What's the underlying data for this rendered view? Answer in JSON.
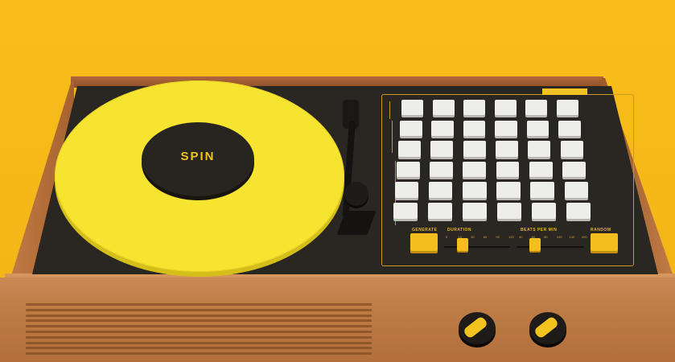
{
  "record_label": "SPIN",
  "panel": {
    "controls": {
      "generate": "GENERATE",
      "duration": "DURATION",
      "bpm": "BEATS PER MIN",
      "random": "RANDOM"
    },
    "duration_ticks": [
      "5",
      "10",
      "30",
      "60",
      "90",
      "120"
    ],
    "bpm_ticks": [
      "40",
      "60",
      "80",
      "100",
      "140",
      "200"
    ]
  },
  "colors": {
    "accent": "#f5be1e",
    "record": "#f7e431",
    "deck": "#2a2621",
    "wood": "#bd7b45"
  }
}
